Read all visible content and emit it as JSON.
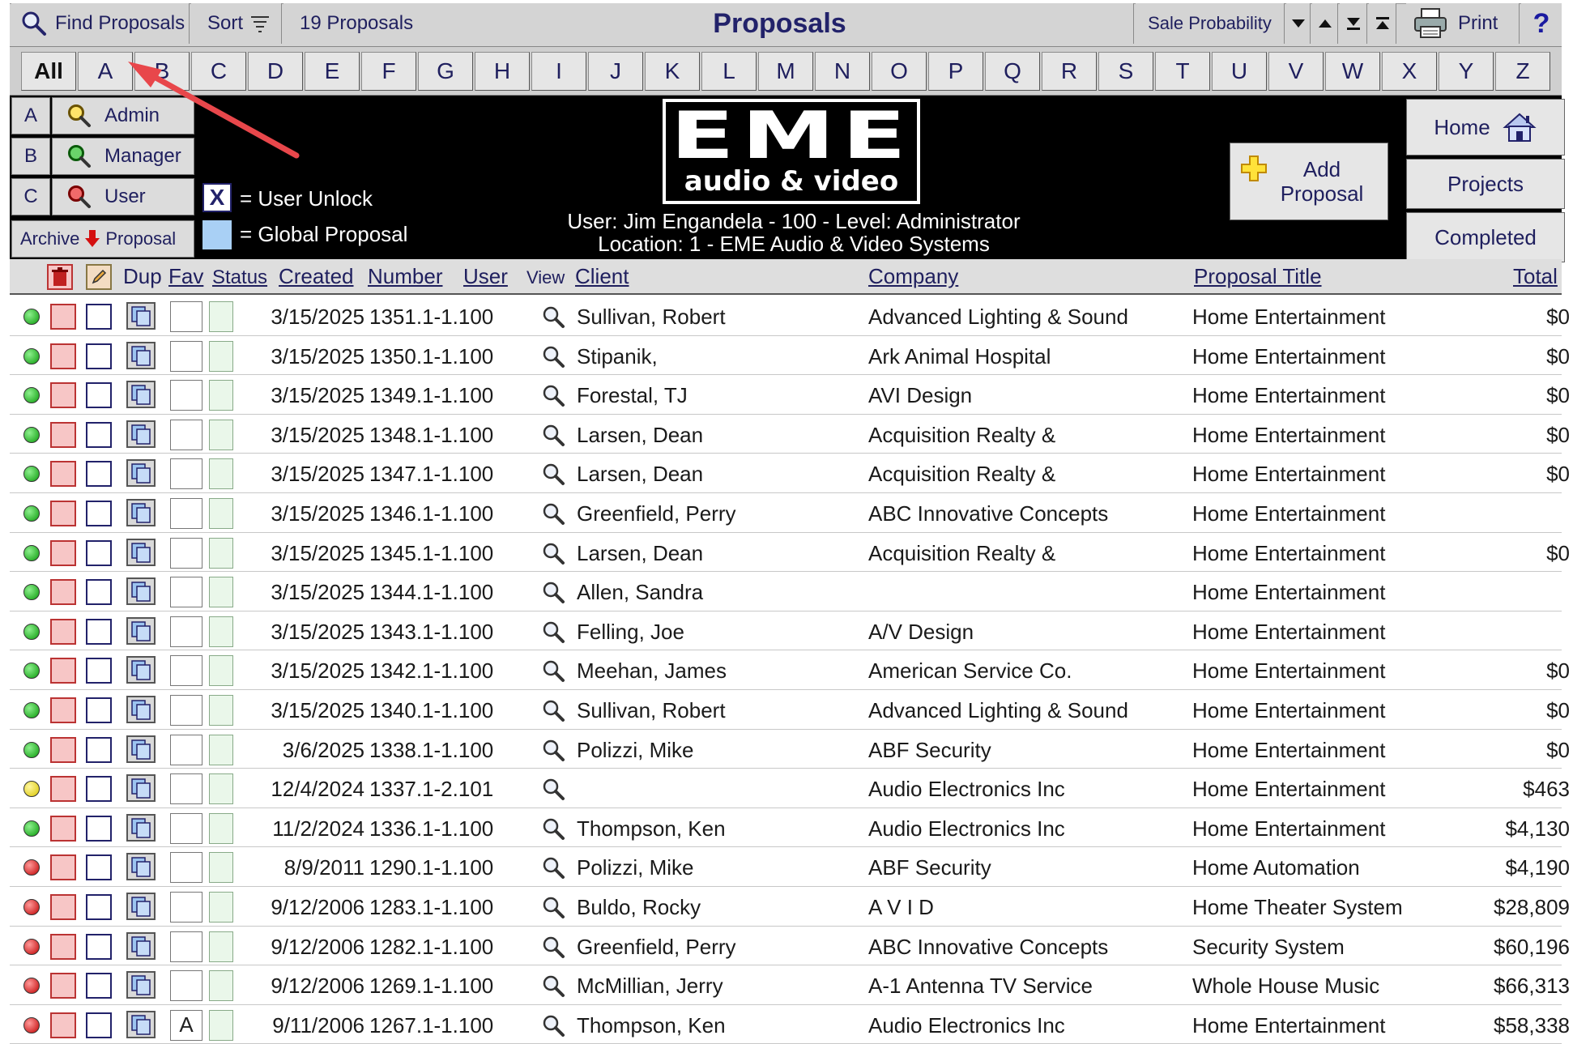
{
  "toolbar": {
    "find_label": "Find Proposals",
    "sort_label": "Sort",
    "count_label": "19 Proposals",
    "title": "Proposals",
    "probability_label": "Sale Probability",
    "print_label": "Print",
    "help_label": "?"
  },
  "letters": [
    "All",
    "A",
    "B",
    "C",
    "D",
    "E",
    "F",
    "G",
    "H",
    "I",
    "J",
    "K",
    "L",
    "M",
    "N",
    "O",
    "P",
    "Q",
    "R",
    "S",
    "T",
    "U",
    "V",
    "W",
    "X",
    "Y",
    "Z"
  ],
  "levels": [
    {
      "letter": "A",
      "label": "Admin",
      "icon": "search-icon-yellow"
    },
    {
      "letter": "B",
      "label": "Manager",
      "icon": "search-icon-green"
    },
    {
      "letter": "C",
      "label": "User",
      "icon": "search-icon-red"
    }
  ],
  "archive": {
    "left": "Archive",
    "right": "Proposal"
  },
  "legend": {
    "unlock_mark": "X",
    "unlock_text": "= User Unlock",
    "global_text": "= Global Proposal"
  },
  "logo": {
    "big": "EME",
    "small": "audio & video"
  },
  "user_info": {
    "line1": "User: Jim Engandela - 100 - Level: Administrator",
    "line2": "Location: 1 - EME Audio & Video Systems"
  },
  "add_proposal": {
    "line1": "Add",
    "line2": "Proposal"
  },
  "nav": {
    "home": "Home",
    "projects": "Projects",
    "completed": "Completed"
  },
  "columns": {
    "dup": "Dup",
    "fav": "Fav",
    "status": "Status",
    "created": "Created",
    "number": "Number",
    "user": "User",
    "view": "View",
    "client": "Client",
    "company": "Company",
    "title": "Proposal Title",
    "total": "Total"
  },
  "colors": {
    "green": "#0a9a0a",
    "yellow": "#d8c400",
    "red": "#c00000",
    "accent": "#22226a"
  },
  "rows": [
    {
      "status": "green",
      "fav": "",
      "created": "3/15/2025",
      "number": "1351.1-1.100",
      "client": "Sullivan, Robert",
      "company": "Advanced Lighting & Sound",
      "title": "Home Entertainment",
      "total": "$0"
    },
    {
      "status": "green",
      "fav": "",
      "created": "3/15/2025",
      "number": "1350.1-1.100",
      "client": "Stipanik,",
      "company": "Ark Animal Hospital",
      "title": "Home Entertainment",
      "total": "$0"
    },
    {
      "status": "green",
      "fav": "",
      "created": "3/15/2025",
      "number": "1349.1-1.100",
      "client": "Forestal, TJ",
      "company": "AVI Design",
      "title": "Home Entertainment",
      "total": "$0"
    },
    {
      "status": "green",
      "fav": "",
      "created": "3/15/2025",
      "number": "1348.1-1.100",
      "client": "Larsen, Dean",
      "company": "Acquisition Realty &",
      "title": "Home Entertainment",
      "total": "$0"
    },
    {
      "status": "green",
      "fav": "",
      "created": "3/15/2025",
      "number": "1347.1-1.100",
      "client": "Larsen, Dean",
      "company": "Acquisition Realty &",
      "title": "Home Entertainment",
      "total": "$0"
    },
    {
      "status": "green",
      "fav": "",
      "created": "3/15/2025",
      "number": "1346.1-1.100",
      "client": "Greenfield, Perry",
      "company": "ABC Innovative Concepts",
      "title": "Home Entertainment",
      "total": ""
    },
    {
      "status": "green",
      "fav": "",
      "created": "3/15/2025",
      "number": "1345.1-1.100",
      "client": "Larsen, Dean",
      "company": "Acquisition Realty &",
      "title": "Home Entertainment",
      "total": "$0"
    },
    {
      "status": "green",
      "fav": "",
      "created": "3/15/2025",
      "number": "1344.1-1.100",
      "client": "Allen, Sandra",
      "company": "",
      "title": "Home Entertainment",
      "total": ""
    },
    {
      "status": "green",
      "fav": "",
      "created": "3/15/2025",
      "number": "1343.1-1.100",
      "client": "Felling, Joe",
      "company": "A/V Design",
      "title": "Home Entertainment",
      "total": ""
    },
    {
      "status": "green",
      "fav": "",
      "created": "3/15/2025",
      "number": "1342.1-1.100",
      "client": "Meehan, James",
      "company": "American Service Co.",
      "title": "Home Entertainment",
      "total": "$0"
    },
    {
      "status": "green",
      "fav": "",
      "created": "3/15/2025",
      "number": "1340.1-1.100",
      "client": "Sullivan, Robert",
      "company": "Advanced Lighting & Sound",
      "title": "Home Entertainment",
      "total": "$0"
    },
    {
      "status": "green",
      "fav": "",
      "created": "3/6/2025",
      "number": "1338.1-1.100",
      "client": "Polizzi, Mike",
      "company": "ABF Security",
      "title": "Home Entertainment",
      "total": "$0"
    },
    {
      "status": "yellow",
      "fav": "",
      "created": "12/4/2024",
      "number": "1337.1-2.101",
      "client": "",
      "company": "Audio Electronics Inc",
      "title": "Home Entertainment",
      "total": "$463"
    },
    {
      "status": "green",
      "fav": "",
      "created": "11/2/2024",
      "number": "1336.1-1.100",
      "client": "Thompson, Ken",
      "company": "Audio Electronics Inc",
      "title": "Home Entertainment",
      "total": "$4,130"
    },
    {
      "status": "red",
      "fav": "",
      "created": "8/9/2011",
      "number": "1290.1-1.100",
      "client": "Polizzi, Mike",
      "company": "ABF Security",
      "title": "Home Automation",
      "total": "$4,190"
    },
    {
      "status": "red",
      "fav": "",
      "created": "9/12/2006",
      "number": "1283.1-1.100",
      "client": "Buldo, Rocky",
      "company": "A V I D",
      "title": "Home Theater System",
      "total": "$28,809"
    },
    {
      "status": "red",
      "fav": "",
      "created": "9/12/2006",
      "number": "1282.1-1.100",
      "client": "Greenfield, Perry",
      "company": "ABC Innovative Concepts",
      "title": "Security System",
      "total": "$60,196"
    },
    {
      "status": "red",
      "fav": "",
      "created": "9/12/2006",
      "number": "1269.1-1.100",
      "client": "McMillian, Jerry",
      "company": "A-1 Antenna TV Service",
      "title": "Whole House Music",
      "total": "$66,313"
    },
    {
      "status": "red",
      "fav": "A",
      "created": "9/11/2006",
      "number": "1267.1-1.100",
      "client": "Thompson, Ken",
      "company": "Audio Electronics Inc",
      "title": "Home Entertainment",
      "total": "$58,338"
    }
  ]
}
